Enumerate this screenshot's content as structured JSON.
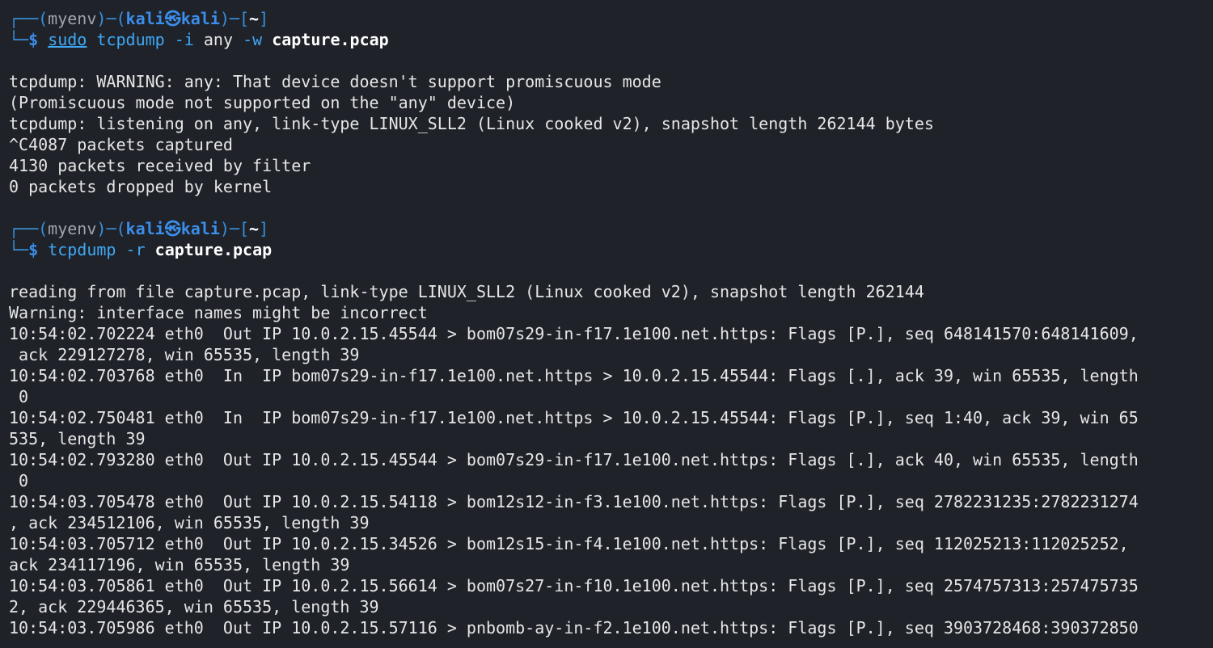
{
  "session1": {
    "frame_top": "┌──",
    "env_open": "(",
    "env_name": "myenv",
    "env_close": ")",
    "dash1": "─",
    "user_open": "(",
    "user": "kali",
    "at": "㉿",
    "host": "kali",
    "user_close": ")",
    "dash2": "─",
    "dir_open": "[",
    "dir": "~",
    "dir_close": "]",
    "frame_bottom": "└─",
    "dollar": "$",
    "sudo": "sudo",
    "cmd": "tcpdump",
    "flag1": "-i",
    "arg1": "any",
    "flag2": "-w",
    "file": "capture.pcap"
  },
  "output1": [
    "",
    "tcpdump: WARNING: any: That device doesn't support promiscuous mode",
    "(Promiscuous mode not supported on the \"any\" device)",
    "tcpdump: listening on any, link-type LINUX_SLL2 (Linux cooked v2), snapshot length 262144 bytes",
    "^C4087 packets captured",
    "4130 packets received by filter",
    "0 packets dropped by kernel",
    ""
  ],
  "session2": {
    "frame_top": "┌──",
    "env_open": "(",
    "env_name": "myenv",
    "env_close": ")",
    "dash1": "─",
    "user_open": "(",
    "user": "kali",
    "at": "㉿",
    "host": "kali",
    "user_close": ")",
    "dash2": "─",
    "dir_open": "[",
    "dir": "~",
    "dir_close": "]",
    "frame_bottom": "└─",
    "dollar": "$",
    "cmd": "tcpdump",
    "flag1": "-r",
    "file": "capture.pcap"
  },
  "output2": [
    "",
    "reading from file capture.pcap, link-type LINUX_SLL2 (Linux cooked v2), snapshot length 262144",
    "Warning: interface names might be incorrect",
    "10:54:02.702224 eth0  Out IP 10.0.2.15.45544 > bom07s29-in-f17.1e100.net.https: Flags [P.], seq 648141570:648141609,",
    " ack 229127278, win 65535, length 39",
    "10:54:02.703768 eth0  In  IP bom07s29-in-f17.1e100.net.https > 10.0.2.15.45544: Flags [.], ack 39, win 65535, length",
    " 0",
    "10:54:02.750481 eth0  In  IP bom07s29-in-f17.1e100.net.https > 10.0.2.15.45544: Flags [P.], seq 1:40, ack 39, win 65",
    "535, length 39",
    "10:54:02.793280 eth0  Out IP 10.0.2.15.45544 > bom07s29-in-f17.1e100.net.https: Flags [.], ack 40, win 65535, length",
    " 0",
    "10:54:03.705478 eth0  Out IP 10.0.2.15.54118 > bom12s12-in-f3.1e100.net.https: Flags [P.], seq 2782231235:2782231274",
    ", ack 234512106, win 65535, length 39",
    "10:54:03.705712 eth0  Out IP 10.0.2.15.34526 > bom12s15-in-f4.1e100.net.https: Flags [P.], seq 112025213:112025252,",
    "ack 234117196, win 65535, length 39",
    "10:54:03.705861 eth0  Out IP 10.0.2.15.56614 > bom07s27-in-f10.1e100.net.https: Flags [P.], seq 2574757313:257475735",
    "2, ack 229446365, win 65535, length 39",
    "10:54:03.705986 eth0  Out IP 10.0.2.15.57116 > pnbomb-ay-in-f2.1e100.net.https: Flags [P.], seq 3903728468:390372850"
  ]
}
